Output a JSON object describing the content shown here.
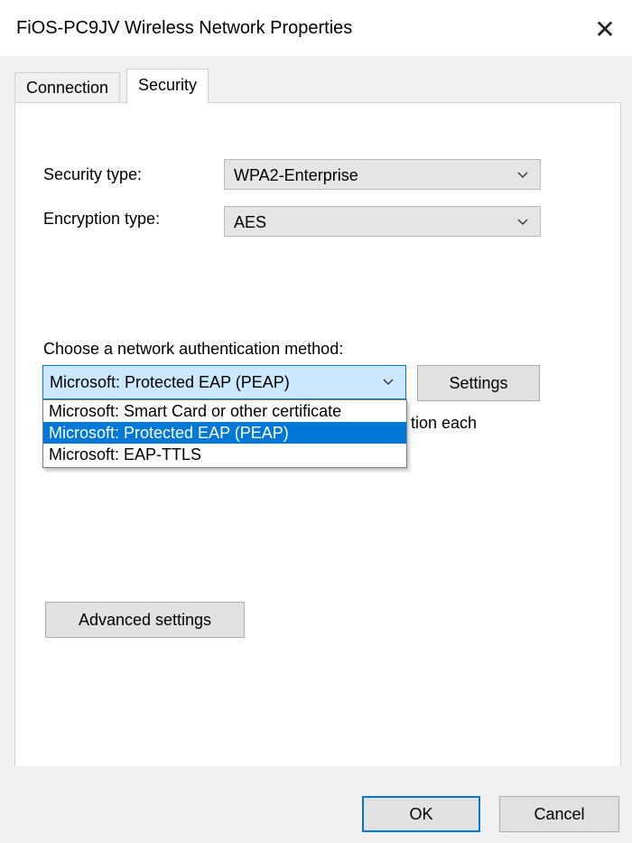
{
  "window": {
    "title": "FiOS-PC9JV Wireless Network Properties",
    "close_glyph": "✕"
  },
  "tabs": [
    {
      "label": "Connection",
      "active": false
    },
    {
      "label": "Security",
      "active": true
    }
  ],
  "security": {
    "security_type_label": "Security type:",
    "security_type_value": "WPA2-Enterprise",
    "encryption_type_label": "Encryption type:",
    "encryption_type_value": "AES",
    "auth_method_label": "Choose a network authentication method:",
    "auth_method_value": "Microsoft: Protected EAP (PEAP)",
    "auth_options": [
      "Microsoft: Smart Card or other certificate",
      "Microsoft: Protected EAP (PEAP)",
      "Microsoft: EAP-TTLS"
    ],
    "selected_option_index": 1,
    "settings_button": "Settings",
    "obscured_text": "tion each",
    "advanced_button": "Advanced settings"
  },
  "footer": {
    "ok_button": "OK",
    "cancel_button": "Cancel"
  },
  "colors": {
    "accent": "#0078d7",
    "selected_bg": "#cce8ff",
    "button_bg": "#e1e1e1"
  },
  "icons": {
    "close": "close-icon",
    "dropdown": "chevron-down-icon"
  }
}
